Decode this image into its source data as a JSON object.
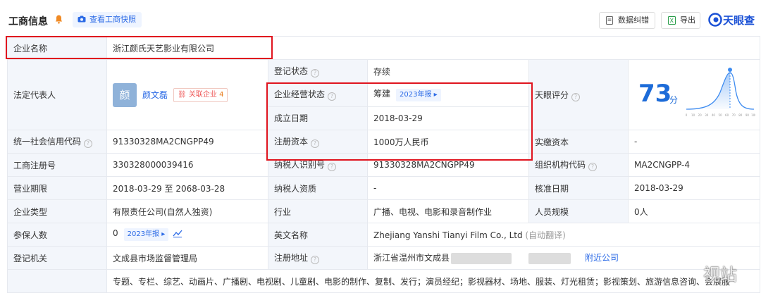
{
  "header": {
    "title": "工商信息",
    "snapshot_label": "查看工商快照",
    "correct_label": "数据纠错",
    "export_label": "导出",
    "brand": "天眼查"
  },
  "rows": {
    "company_name": {
      "key": "企业名称",
      "value": "浙江颜氏天艺影业有限公司"
    },
    "status": {
      "key": "登记状态",
      "value": "存续"
    },
    "legal_rep": {
      "key": "法定代表人",
      "avatar": "颜",
      "name": "颜文磊",
      "related_label": "关联企业",
      "related_count": "4"
    },
    "op_status": {
      "key": "企业经营状态",
      "value": "筹建",
      "report": "2023年报"
    },
    "found_date": {
      "key": "成立日期",
      "value": "2018-03-29"
    },
    "reg_capital": {
      "key": "注册资本",
      "value": "1000万人民币"
    },
    "tianyan_score": {
      "key": "天眼评分",
      "value": "73",
      "unit": "分",
      "axis_ticks": [
        "0",
        "5",
        "10",
        "15",
        "20",
        "25",
        "30",
        "35",
        "40",
        "45",
        "50",
        "55",
        "60",
        "65",
        "70",
        "75",
        "80",
        "85",
        "90",
        "95",
        "100"
      ]
    },
    "credit_code": {
      "key": "统一社会信用代码",
      "value": "91330328MA2CNGPP49"
    },
    "paid_capital": {
      "key": "实缴资本",
      "value": "-"
    },
    "biz_reg_no": {
      "key": "工商注册号",
      "value": "330328000039416"
    },
    "taxpayer_id": {
      "key": "纳税人识别号",
      "value": "91330328MA2CNGPP49"
    },
    "org_code": {
      "key": "组织机构代码",
      "value": "MA2CNGPP-4"
    },
    "term": {
      "key": "营业期限",
      "value": "2018-03-29 至 2068-03-28"
    },
    "taxpayer_qual": {
      "key": "纳税人资质",
      "value": "-"
    },
    "approve_date": {
      "key": "核准日期",
      "value": "2018-03-29"
    },
    "company_type": {
      "key": "企业类型",
      "value": "有限责任公司(自然人独资)"
    },
    "industry": {
      "key": "行业",
      "value": "广播、电视、电影和录音制作业"
    },
    "staff_size": {
      "key": "人员规模",
      "value": "0人"
    },
    "insured": {
      "key": "参保人数",
      "value": "0",
      "report": "2023年报"
    },
    "english_name": {
      "key": "英文名称",
      "value": "Zhejiang Yanshi Tianyi Film Co., Ltd",
      "note": "(自动翻译)"
    },
    "reg_authority": {
      "key": "登记机关",
      "value": "文成县市场监督管理局"
    },
    "reg_address": {
      "key": "注册地址",
      "value": "浙江省温州市文成县",
      "nearby": "附近公司"
    },
    "scope": {
      "value": "专题、专栏、综艺、动画片、广播剧、电视剧、儿童剧、电影的制作、复制、发行；演员经纪；影视器材、场地、服装、灯光租赁；影视策划、旅游信息咨询、会展服"
    }
  },
  "watermark": "视站",
  "colors": {
    "accent": "#2b6ae6",
    "highlight": "#e0141e",
    "status": "#2bb24c"
  }
}
